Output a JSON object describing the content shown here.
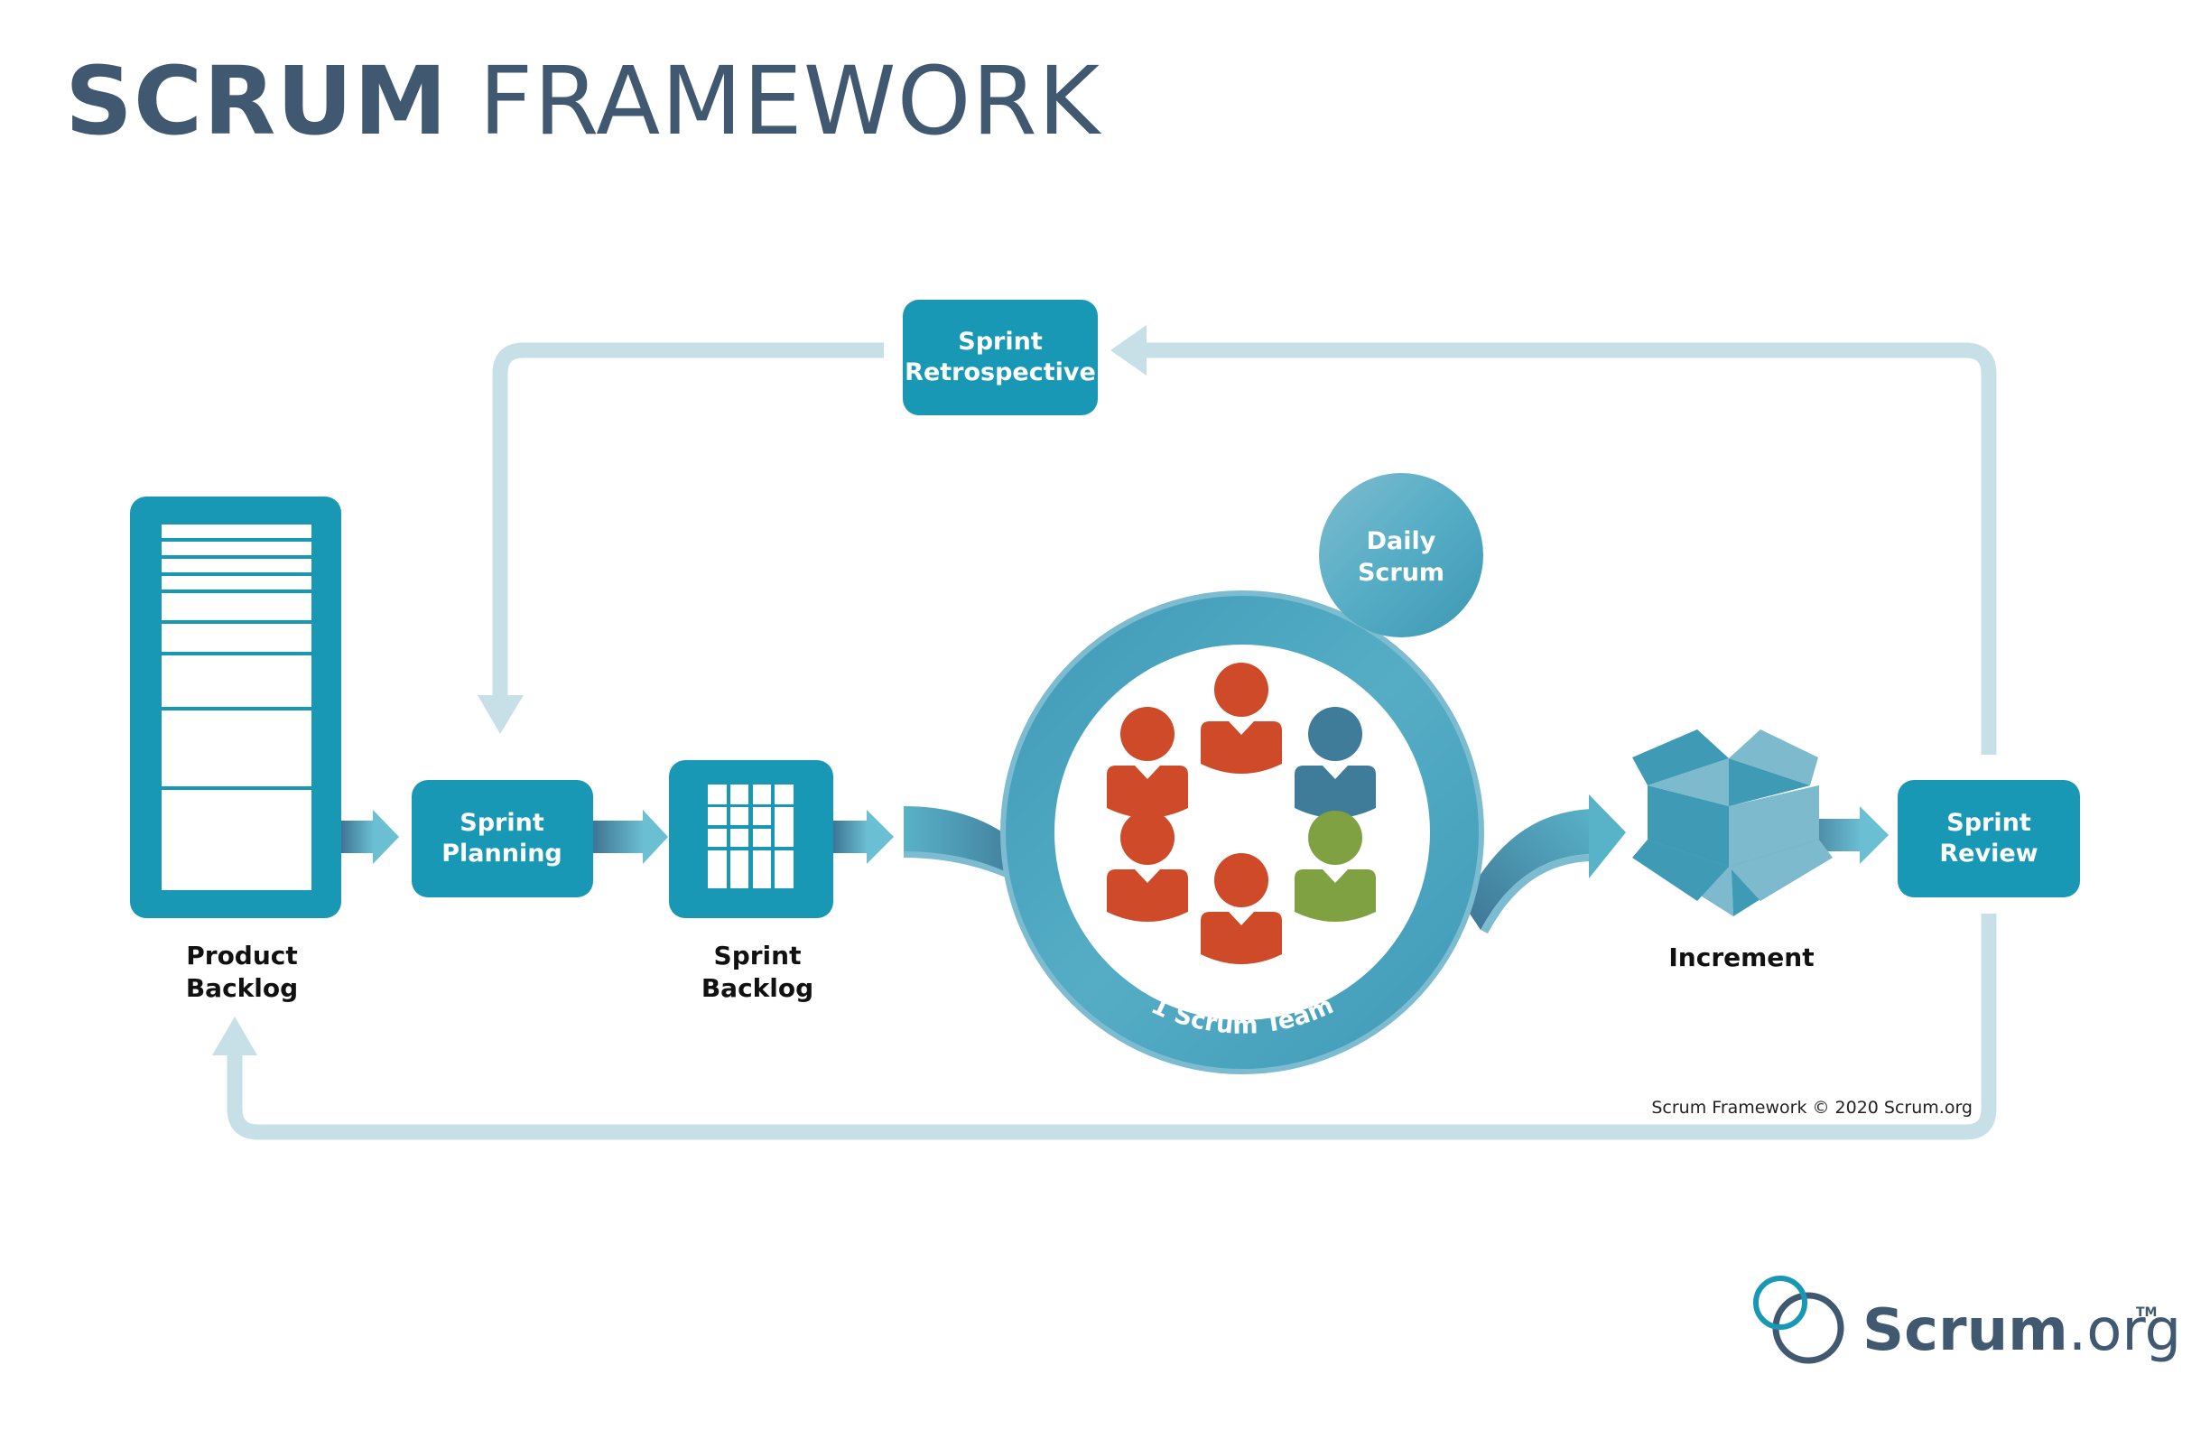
{
  "title": {
    "bold": "SCRUM",
    "light": "FRAMEWORK"
  },
  "colors": {
    "title": "#405870",
    "box": "#1998B5",
    "loop": "#C7E0E8",
    "ring": "#4DA8C2",
    "ring_edge": "#7DBCD0",
    "arrow_dark": "#3E7594",
    "arrow_light": "#6BBFD2",
    "person_orange": "#CE4A28",
    "person_blue": "#3E7C99",
    "person_green": "#7FA142",
    "increment_dark": "#3F9BB5",
    "increment_light": "#7DBACD"
  },
  "artifacts": {
    "product_backlog": {
      "label_line1": "Product",
      "label_line2": "Backlog"
    },
    "sprint_backlog": {
      "label_line1": "Sprint",
      "label_line2": "Backlog"
    },
    "increment": {
      "label": "Increment"
    }
  },
  "events": {
    "sprint_planning": {
      "line1": "Sprint",
      "line2": "Planning"
    },
    "sprint_review": {
      "line1": "Sprint",
      "line2": "Review"
    },
    "sprint_retrospective": {
      "line1": "Sprint",
      "line2": "Retrospective"
    },
    "daily_scrum": {
      "line1": "Daily",
      "line2": "Scrum"
    }
  },
  "team": {
    "label": "1 Scrum Team",
    "members": [
      {
        "position": "top",
        "color": "orange"
      },
      {
        "position": "upper-left",
        "color": "orange"
      },
      {
        "position": "upper-right",
        "color": "blue"
      },
      {
        "position": "lower-left",
        "color": "orange"
      },
      {
        "position": "lower-right",
        "color": "green"
      },
      {
        "position": "bottom",
        "color": "orange"
      }
    ]
  },
  "copyright": "Scrum Framework © 2020 Scrum.org",
  "logo": {
    "main": "Scrum",
    "suffix": ".org",
    "tm": "TM"
  }
}
